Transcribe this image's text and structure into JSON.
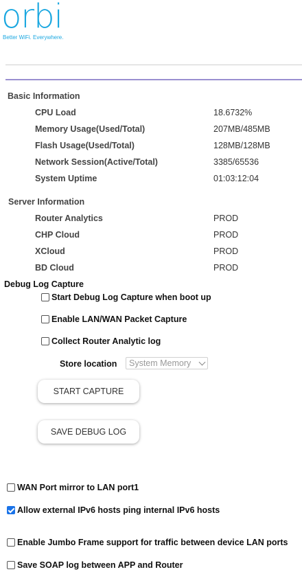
{
  "logo": {
    "wordmark": "orbi",
    "tagline": "Better WiFi. Everywhere."
  },
  "basic_info": {
    "title": "Basic Information",
    "rows": [
      {
        "label": "CPU Load",
        "value": "18.6732%"
      },
      {
        "label": "Memory Usage(Used/Total)",
        "value": "207MB/485MB"
      },
      {
        "label": "Flash Usage(Used/Total)",
        "value": "128MB/128MB"
      },
      {
        "label": "Network Session(Active/Total)",
        "value": "3385/65536"
      },
      {
        "label": "System Uptime",
        "value": "01:03:12:04"
      }
    ]
  },
  "server_info": {
    "title": "Server Information",
    "rows": [
      {
        "label": "Router Analytics",
        "value": "PROD"
      },
      {
        "label": "CHP Cloud",
        "value": "PROD"
      },
      {
        "label": "XCloud",
        "value": "PROD"
      },
      {
        "label": "BD Cloud",
        "value": "PROD"
      }
    ]
  },
  "debug": {
    "title": "Debug Log Capture",
    "options": [
      {
        "label": "Start Debug Log Capture when boot up",
        "checked": false
      },
      {
        "label": "Enable LAN/WAN Packet Capture",
        "checked": false
      },
      {
        "label": "Collect Router Analytic log",
        "checked": false
      }
    ],
    "store_location_label": "Store location",
    "store_location_value": "System Memory",
    "start_button": "START CAPTURE",
    "save_button": "SAVE DEBUG LOG"
  },
  "settings": [
    {
      "label": "WAN Port mirror to LAN port1",
      "checked": false
    },
    {
      "label": "Allow external IPv6 hosts ping internal IPv6 hosts",
      "checked": true
    },
    {
      "label": "Enable Jumbo Frame support for traffic between device LAN ports",
      "checked": false
    },
    {
      "label": "Save SOAP log between APP and Router",
      "checked": false
    }
  ],
  "colors": {
    "brand": "#1aa7e0",
    "divider": "#9a8fd0",
    "checkbox_on": "#1a73e8"
  }
}
